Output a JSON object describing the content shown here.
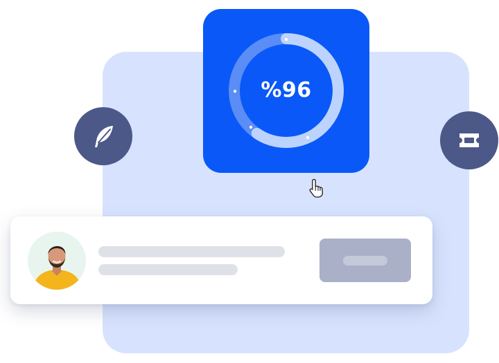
{
  "stat": {
    "percent_label": "%96",
    "progress_percent": 96
  },
  "icons": {
    "left": "feather-icon",
    "right": "ticket-icon",
    "cursor": "hand-pointer-icon"
  },
  "colors": {
    "background_panel": "#d7e3fe",
    "stat_card": "#0a58f7",
    "icon_circle": "#4b5888",
    "action_button": "#aab0c8",
    "placeholder_line": "#dfe1e9"
  },
  "profile_card": {
    "avatar": "person-avatar",
    "action_button": "placeholder-button"
  }
}
